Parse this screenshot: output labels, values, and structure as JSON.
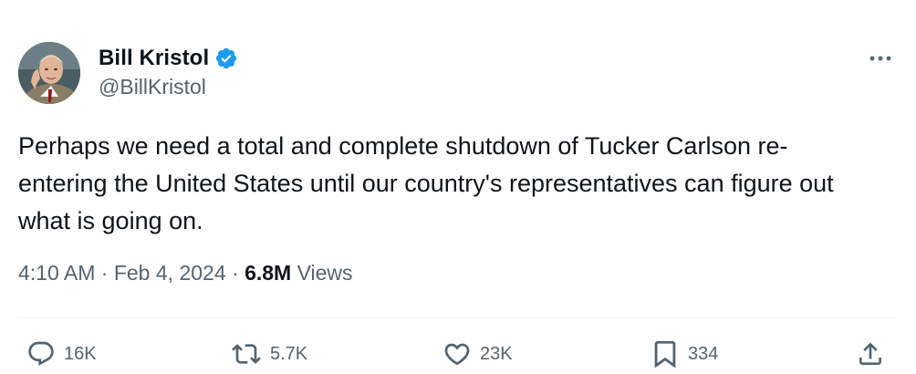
{
  "author": {
    "display_name": "Bill Kristol",
    "handle": "@BillKristol",
    "verified": true,
    "verified_color": "#1d9bf0"
  },
  "tweet": {
    "text": "Perhaps we need a total and complete shutdown of Tucker Carlson re-entering the United States until our country's representatives can figure out what is going on.",
    "time": "4:10 AM",
    "separator": "·",
    "date": "Feb 4, 2024",
    "views_count": "6.8M",
    "views_label": "Views"
  },
  "actions": {
    "replies": "16K",
    "reposts": "5.7K",
    "likes": "23K",
    "bookmarks": "334"
  },
  "icons": {
    "more": "more-horizontal-icon",
    "reply": "reply-bubble-icon",
    "repost": "repost-arrows-icon",
    "like": "heart-icon",
    "bookmark": "bookmark-icon",
    "share": "share-upload-icon"
  },
  "colors": {
    "text": "#0f1419",
    "secondary": "#536471",
    "divider": "#eff3f4"
  }
}
